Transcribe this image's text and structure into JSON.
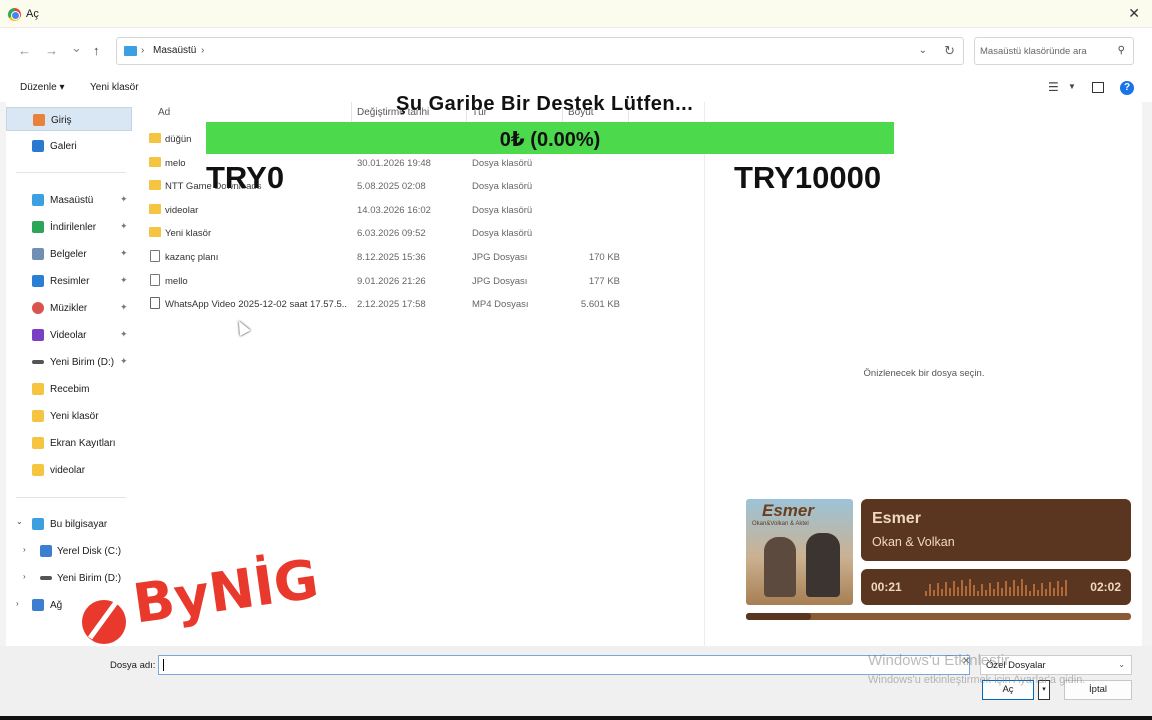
{
  "window": {
    "title": "Aç",
    "close_glyph": "✕",
    "app_icon": "chrome-icon"
  },
  "nav": {
    "back_glyph": "←",
    "forward_glyph": "→",
    "recent_glyph": "⌄",
    "up_glyph": "↑",
    "breadcrumb": [
      "Masaüstü"
    ],
    "separator": "›",
    "refresh_glyph": "↻",
    "search_placeholder": "Masaüstü klasöründe ara",
    "search_glyph": "⚲"
  },
  "toolbar": {
    "organize": "Düzenle ▾",
    "new_folder": "Yeni klasör",
    "help": "?"
  },
  "sidebar": {
    "top": [
      {
        "label": "Giriş",
        "icon": "home-icon",
        "color": "#e8813a",
        "selected": true
      },
      {
        "label": "Galeri",
        "icon": "gallery-icon",
        "color": "#2b78d0"
      }
    ],
    "pinned": [
      {
        "label": "Masaüstü",
        "icon": "desktop-icon",
        "color": "#3c9fe0"
      },
      {
        "label": "İndirilenler",
        "icon": "download-icon",
        "color": "#2ba55a"
      },
      {
        "label": "Belgeler",
        "icon": "documents-icon",
        "color": "#6f8fb3"
      },
      {
        "label": "Resimler",
        "icon": "pictures-icon",
        "color": "#2a7fd4"
      },
      {
        "label": "Müzikler",
        "icon": "music-icon",
        "color": "#d9534f"
      },
      {
        "label": "Videolar",
        "icon": "videos-icon",
        "color": "#7b3fc4"
      },
      {
        "label": "Yeni Birim (D:)",
        "icon": "drive-icon",
        "color": "#555555"
      }
    ],
    "folders": [
      {
        "label": "Recebim",
        "icon": "folder-icon",
        "color": "#f5c542"
      },
      {
        "label": "Yeni klasör",
        "icon": "folder-icon",
        "color": "#f5c542"
      },
      {
        "label": "Ekran Kayıtları",
        "icon": "folder-icon",
        "color": "#f5c542"
      },
      {
        "label": "videolar",
        "icon": "folder-icon",
        "color": "#f5c542"
      }
    ],
    "tree": [
      {
        "label": "Bu bilgisayar",
        "icon": "pc-icon",
        "color": "#3c9fe0",
        "expanded": true
      },
      {
        "label": "Yerel Disk (C:)",
        "icon": "windows-drive-icon",
        "color": "#3c7fd0"
      },
      {
        "label": "Yeni Birim (D:)",
        "icon": "drive-icon",
        "color": "#555555"
      },
      {
        "label": "Ağ",
        "icon": "network-icon",
        "color": "#3c7fd0"
      }
    ],
    "pin_glyph": "📌",
    "arrow_down": "⌄",
    "arrow_right": "›"
  },
  "columns": {
    "name": "Ad",
    "date": "Değiştirme tarihi",
    "type": "Tür",
    "size": "Boyut"
  },
  "files": [
    {
      "name": "düğün",
      "date": "",
      "type": "",
      "size": "",
      "kind": "folder"
    },
    {
      "name": "melo",
      "date": "30.01.2026 19:48",
      "type": "Dosya klasörü",
      "size": "",
      "kind": "folder"
    },
    {
      "name": "NTT Game Downloads",
      "date": "5.08.2025 02:08",
      "type": "Dosya klasörü",
      "size": "",
      "kind": "folder"
    },
    {
      "name": "videolar",
      "date": "14.03.2026 16:02",
      "type": "Dosya klasörü",
      "size": "",
      "kind": "folder"
    },
    {
      "name": "Yeni klasör",
      "date": "6.03.2026 09:52",
      "type": "Dosya klasörü",
      "size": "",
      "kind": "folder"
    },
    {
      "name": "kazanç planı",
      "date": "8.12.2025 15:36",
      "type": "JPG Dosyası",
      "size": "170 KB",
      "kind": "file"
    },
    {
      "name": "mello",
      "date": "9.01.2026 21:26",
      "type": "JPG Dosyası",
      "size": "177 KB",
      "kind": "file"
    },
    {
      "name": "WhatsApp Video 2025-12-02 saat 17.57.5...",
      "date": "2.12.2025 17:58",
      "type": "MP4 Dosyası",
      "size": "5.601 KB",
      "kind": "video"
    }
  ],
  "preview": {
    "hint": "Önizlenecek bir dosya seçin."
  },
  "bottom": {
    "filename_label": "Dosya adı:",
    "filename_value": "",
    "clear_glyph": "✕",
    "filter_value": "Özel Dosyalar",
    "filter_chev": "⌄",
    "open": "Aç",
    "split_glyph": "▾",
    "cancel": "İptal"
  },
  "watermark": {
    "line1": "Windows'u Etkinleştir",
    "line2": "Windows'u etkinleştirmek için Ayarlar'a gidin."
  },
  "donation": {
    "title": "Şu Garibe Bir Destek Lütfen...",
    "progress_text": "0₺ (0.00%)",
    "progress_fraction": 0.0,
    "min": "TRY0",
    "max": "TRY10000",
    "bar_color": "#4cd94c"
  },
  "logo": {
    "text": "ByNİG",
    "color": "#e8392c"
  },
  "music": {
    "cover_title": "Esmer",
    "cover_subtitle": "Okan&Volkan & Aktel",
    "song": "Esmer",
    "artist": "Okan & Volkan",
    "elapsed": "00:21",
    "duration": "02:02",
    "progress_fraction": 0.17
  }
}
